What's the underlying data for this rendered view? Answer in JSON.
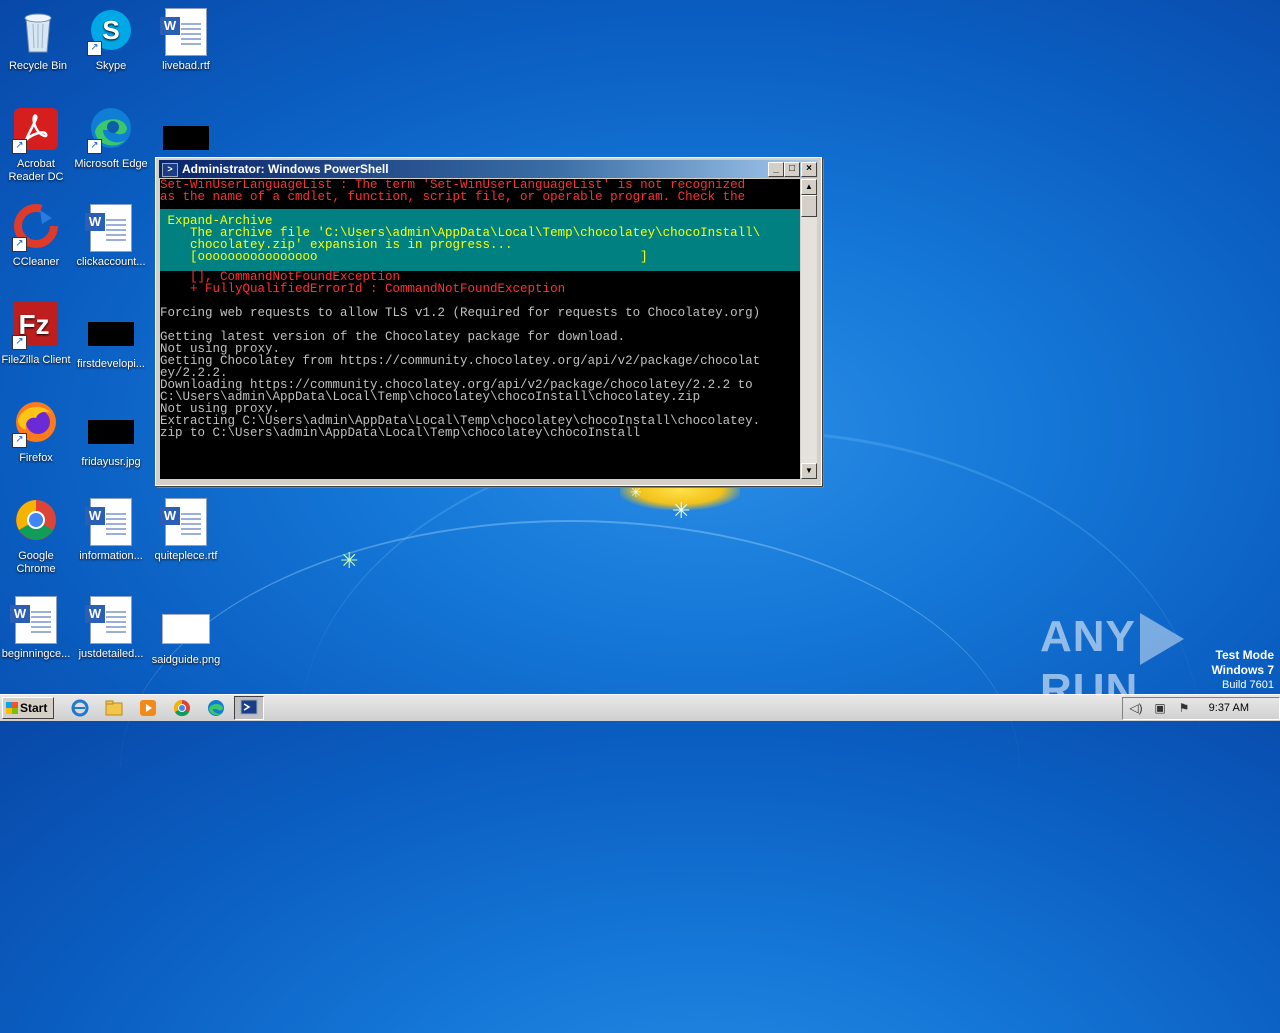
{
  "desktop": {
    "icons": [
      {
        "label": "Recycle Bin"
      },
      {
        "label": "Skype"
      },
      {
        "label": "livebad.rtf"
      },
      {
        "label": "Acrobat Reader DC"
      },
      {
        "label": "Microsoft Edge"
      },
      {
        "label": ""
      },
      {
        "label": "CCleaner"
      },
      {
        "label": "clickaccount..."
      },
      {
        "label": "FileZilla Client"
      },
      {
        "label": "firstdevelopi..."
      },
      {
        "label": "Firefox"
      },
      {
        "label": "fridayusr.jpg"
      },
      {
        "label": "Google Chrome"
      },
      {
        "label": "information..."
      },
      {
        "label": "quiteplece.rtf"
      },
      {
        "label": "beginningce..."
      },
      {
        "label": "justdetailed..."
      },
      {
        "label": "saidguide.png"
      }
    ]
  },
  "powershell": {
    "title": "Administrator: Windows PowerShell",
    "error_top": [
      "Set-WinUserLanguageList : The term 'Set-WinUserLanguageList' is not recognized",
      "as the name of a cmdlet, function, script file, or operable program. Check the"
    ],
    "progress": {
      "activity": " Expand-Archive",
      "status1": "    The archive file 'C:\\Users\\admin\\AppData\\Local\\Temp\\chocolatey\\chocoInstall\\",
      "status2": "    chocolatey.zip' expansion is in progress...",
      "bar": "    [oooooooooooooooo                                           ]"
    },
    "error_tail": [
      "    [], CommandNotFoundException",
      "    + FullyQualifiedErrorId : CommandNotFoundException"
    ],
    "output": [
      "",
      "Forcing web requests to allow TLS v1.2 (Required for requests to Chocolatey.org)",
      "",
      "Getting latest version of the Chocolatey package for download.",
      "Not using proxy.",
      "Getting Chocolatey from https://community.chocolatey.org/api/v2/package/chocolat",
      "ey/2.2.2.",
      "Downloading https://community.chocolatey.org/api/v2/package/chocolatey/2.2.2 to",
      "C:\\Users\\admin\\AppData\\Local\\Temp\\chocolatey\\chocoInstall\\chocolatey.zip",
      "Not using proxy.",
      "Extracting C:\\Users\\admin\\AppData\\Local\\Temp\\chocolatey\\chocoInstall\\chocolatey.",
      "zip to C:\\Users\\admin\\AppData\\Local\\Temp\\chocolatey\\chocoInstall"
    ],
    "buttons": {
      "minimize": "_",
      "maximize": "□",
      "close": "×"
    }
  },
  "watermark": {
    "text_left": "ANY",
    "text_right": "RUN"
  },
  "testmode": {
    "line1": "Test Mode",
    "line2": "Windows 7",
    "line3": "Build 7601"
  },
  "taskbar": {
    "start_label": "Start",
    "clock": "9:37 AM",
    "apps": [
      "ie-icon",
      "explorer-icon",
      "media-player-icon",
      "chrome-icon",
      "edge-icon",
      "powershell-icon"
    ]
  }
}
